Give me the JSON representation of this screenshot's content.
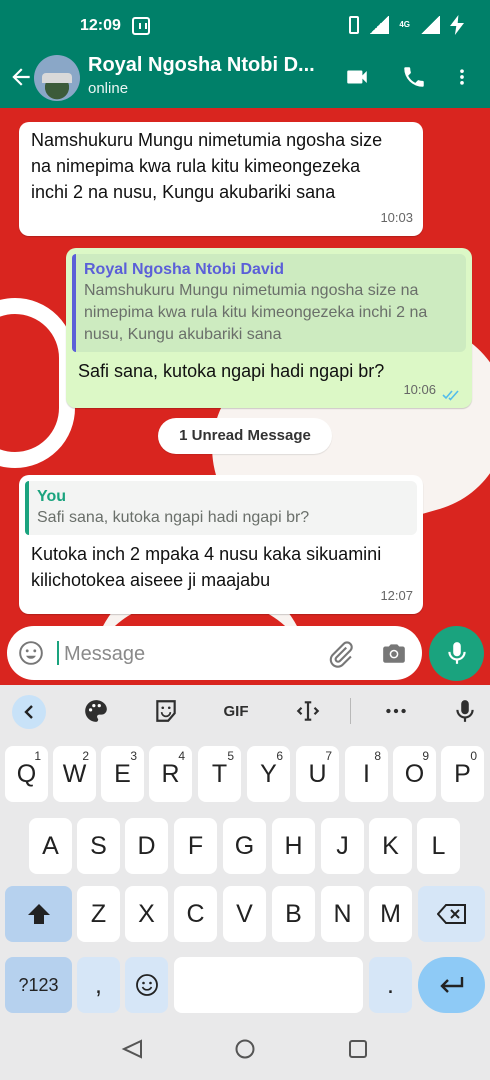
{
  "status_bar": {
    "time": "12:09",
    "network_label": "4G"
  },
  "header": {
    "title": "Royal Ngosha Ntobi D...",
    "subtitle": "online"
  },
  "messages": [
    {
      "direction": "incoming",
      "text": "Namshukuru Mungu nimetumia ngosha size na nimepima kwa rula kitu kimeongezeka inchi 2 na nusu, Kungu akubariki sana",
      "time": "10:03"
    },
    {
      "direction": "outgoing",
      "quote_name": "Royal Ngosha Ntobi David",
      "quote_text": "Namshukuru Mungu nimetumia ngosha size na nimepima kwa rula kitu kimeongezeka inchi 2 na nusu, Kungu akubariki sana",
      "text": "Safi sana, kutoka ngapi hadi ngapi br?",
      "time": "10:06",
      "status": "read"
    },
    {
      "direction": "incoming",
      "quote_name": "You",
      "quote_text": "Safi sana, kutoka ngapi hadi ngapi br?",
      "text": "Kutoka inch 2 mpaka 4 nusu kaka sikuamini kilichotokea aiseee ji maajabu",
      "time": "12:07"
    }
  ],
  "unread_label": "1 Unread Message",
  "composer": {
    "placeholder": "Message"
  },
  "keyboard": {
    "toolbar": {
      "gif": "GIF"
    },
    "row1": [
      "Q",
      "W",
      "E",
      "R",
      "T",
      "Y",
      "U",
      "I",
      "O",
      "P"
    ],
    "row1_nums": [
      "1",
      "2",
      "3",
      "4",
      "5",
      "6",
      "7",
      "8",
      "9",
      "0"
    ],
    "row2": [
      "A",
      "S",
      "D",
      "F",
      "G",
      "H",
      "J",
      "K",
      "L"
    ],
    "row3": [
      "Z",
      "X",
      "C",
      "V",
      "B",
      "N",
      "M"
    ],
    "sym_key": "?123",
    "comma": ",",
    "period": "."
  },
  "colors": {
    "header": "#008069",
    "accent": "#1aa37e",
    "outgoing": "#dcf8c6",
    "wallpaper": "#d9251f"
  }
}
